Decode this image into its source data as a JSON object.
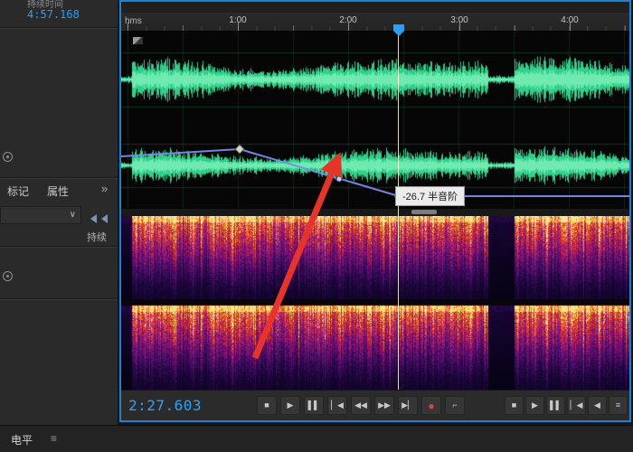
{
  "sidebar": {
    "top_stat_label": "持续时间",
    "top_stat_value": "4:57.168",
    "tab_markers": "标记",
    "tab_properties": "属性",
    "tabs_overflow": "»",
    "dropdown_chevron": "∨",
    "duration_label": "持续"
  },
  "ruler": {
    "unit_label": "hms",
    "ticks": [
      "1:00",
      "2:00",
      "3:00",
      "4:00"
    ]
  },
  "editor": {
    "tooltip_text": "-26.7 半音阶"
  },
  "transport": {
    "time_display": "2:27.603",
    "buttons_left": [
      {
        "name": "stop",
        "glyph": "■"
      },
      {
        "name": "play",
        "glyph": "▶"
      },
      {
        "name": "pause",
        "glyph": "▌▌"
      },
      {
        "name": "skip-back",
        "glyph": "▏◀"
      },
      {
        "name": "rewind",
        "glyph": "◀◀"
      },
      {
        "name": "fast-forward",
        "glyph": "▶▶"
      },
      {
        "name": "skip-forward",
        "glyph": "▶▏"
      },
      {
        "name": "record",
        "glyph": "●"
      },
      {
        "name": "cue",
        "glyph": "⌐"
      }
    ],
    "buttons_right": [
      {
        "name": "stop-2",
        "glyph": "■"
      },
      {
        "name": "play-2",
        "glyph": "▶"
      },
      {
        "name": "pause-2",
        "glyph": "▌▌"
      },
      {
        "name": "skip-start",
        "glyph": "▏◀"
      },
      {
        "name": "step-back",
        "glyph": "◀"
      },
      {
        "name": "transport-menu",
        "glyph": "≡"
      }
    ]
  },
  "bottom_panel": {
    "tab_label": "电平",
    "menu_glyph": "≡"
  },
  "colors": {
    "accent_blue": "#2a9df4",
    "waveform_green": "#2fd08a",
    "envelope_blue": "#7b8bed",
    "record_red": "#e34040",
    "arrow_red": "#e8332a"
  }
}
